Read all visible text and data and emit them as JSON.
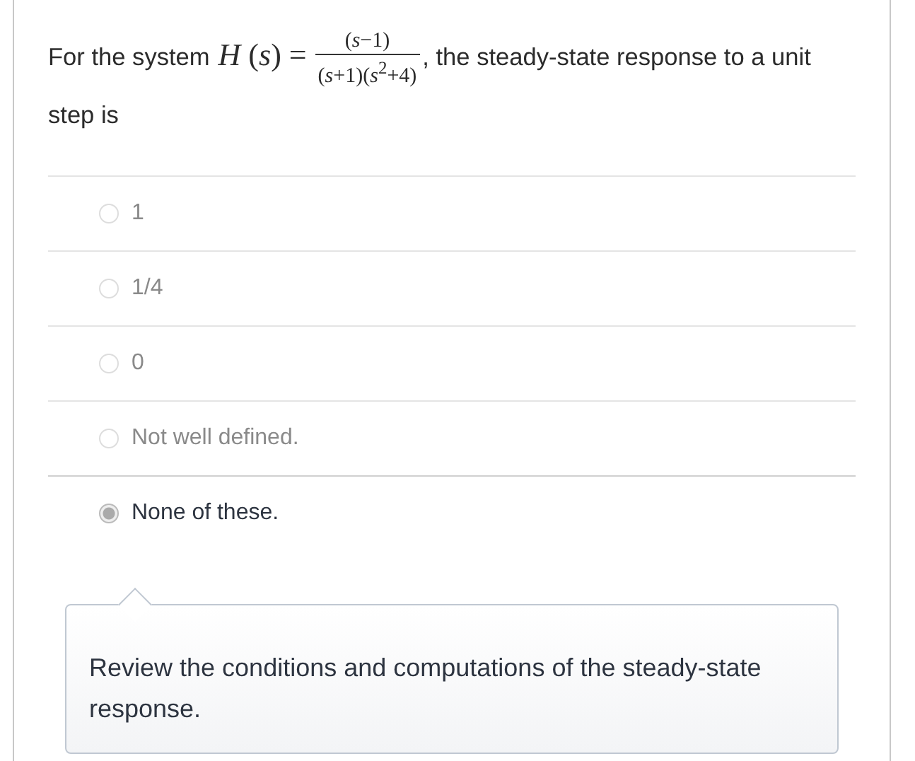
{
  "question": {
    "before": "For the system",
    "lhs": "*H* (*s*) =",
    "numerator": "(*s*−1)",
    "denominator": "(*s*+1)(*s*$^{2}$+4)",
    "after": ", the steady-state response to a unit step is"
  },
  "options": [
    {
      "label": "1",
      "selected": false
    },
    {
      "label": "1/4",
      "selected": false
    },
    {
      "label": "0",
      "selected": false
    },
    {
      "label": "Not well defined.",
      "selected": false
    },
    {
      "label": "None of these.",
      "selected": true
    }
  ],
  "feedback": "Review the conditions and computations of the steady-state response."
}
